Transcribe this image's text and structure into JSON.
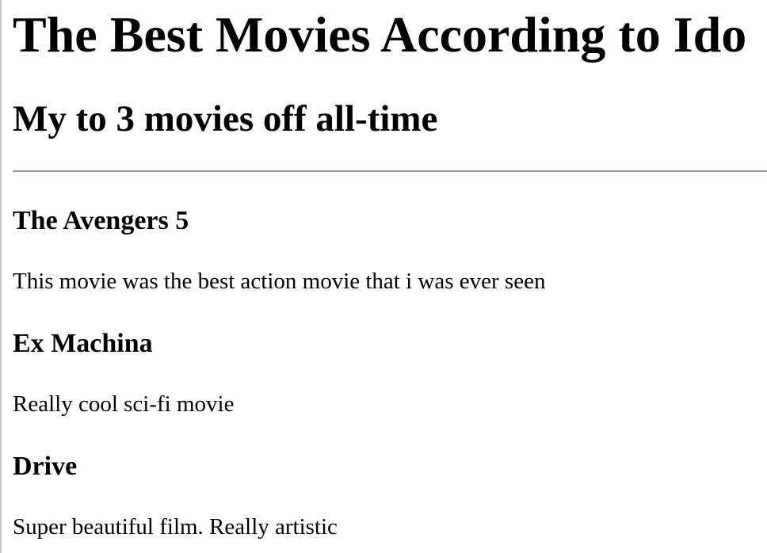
{
  "page": {
    "title": "The Best Movies According to Ido",
    "subtitle": "My to 3 movies off all-time"
  },
  "movies": [
    {
      "name": "The Avengers 5",
      "description": "This movie was the best action movie that i was ever seen"
    },
    {
      "name": "Ex Machina",
      "description": "Really cool sci-fi movie"
    },
    {
      "name": "Drive",
      "description": "Super beautiful film. Really artistic"
    }
  ]
}
